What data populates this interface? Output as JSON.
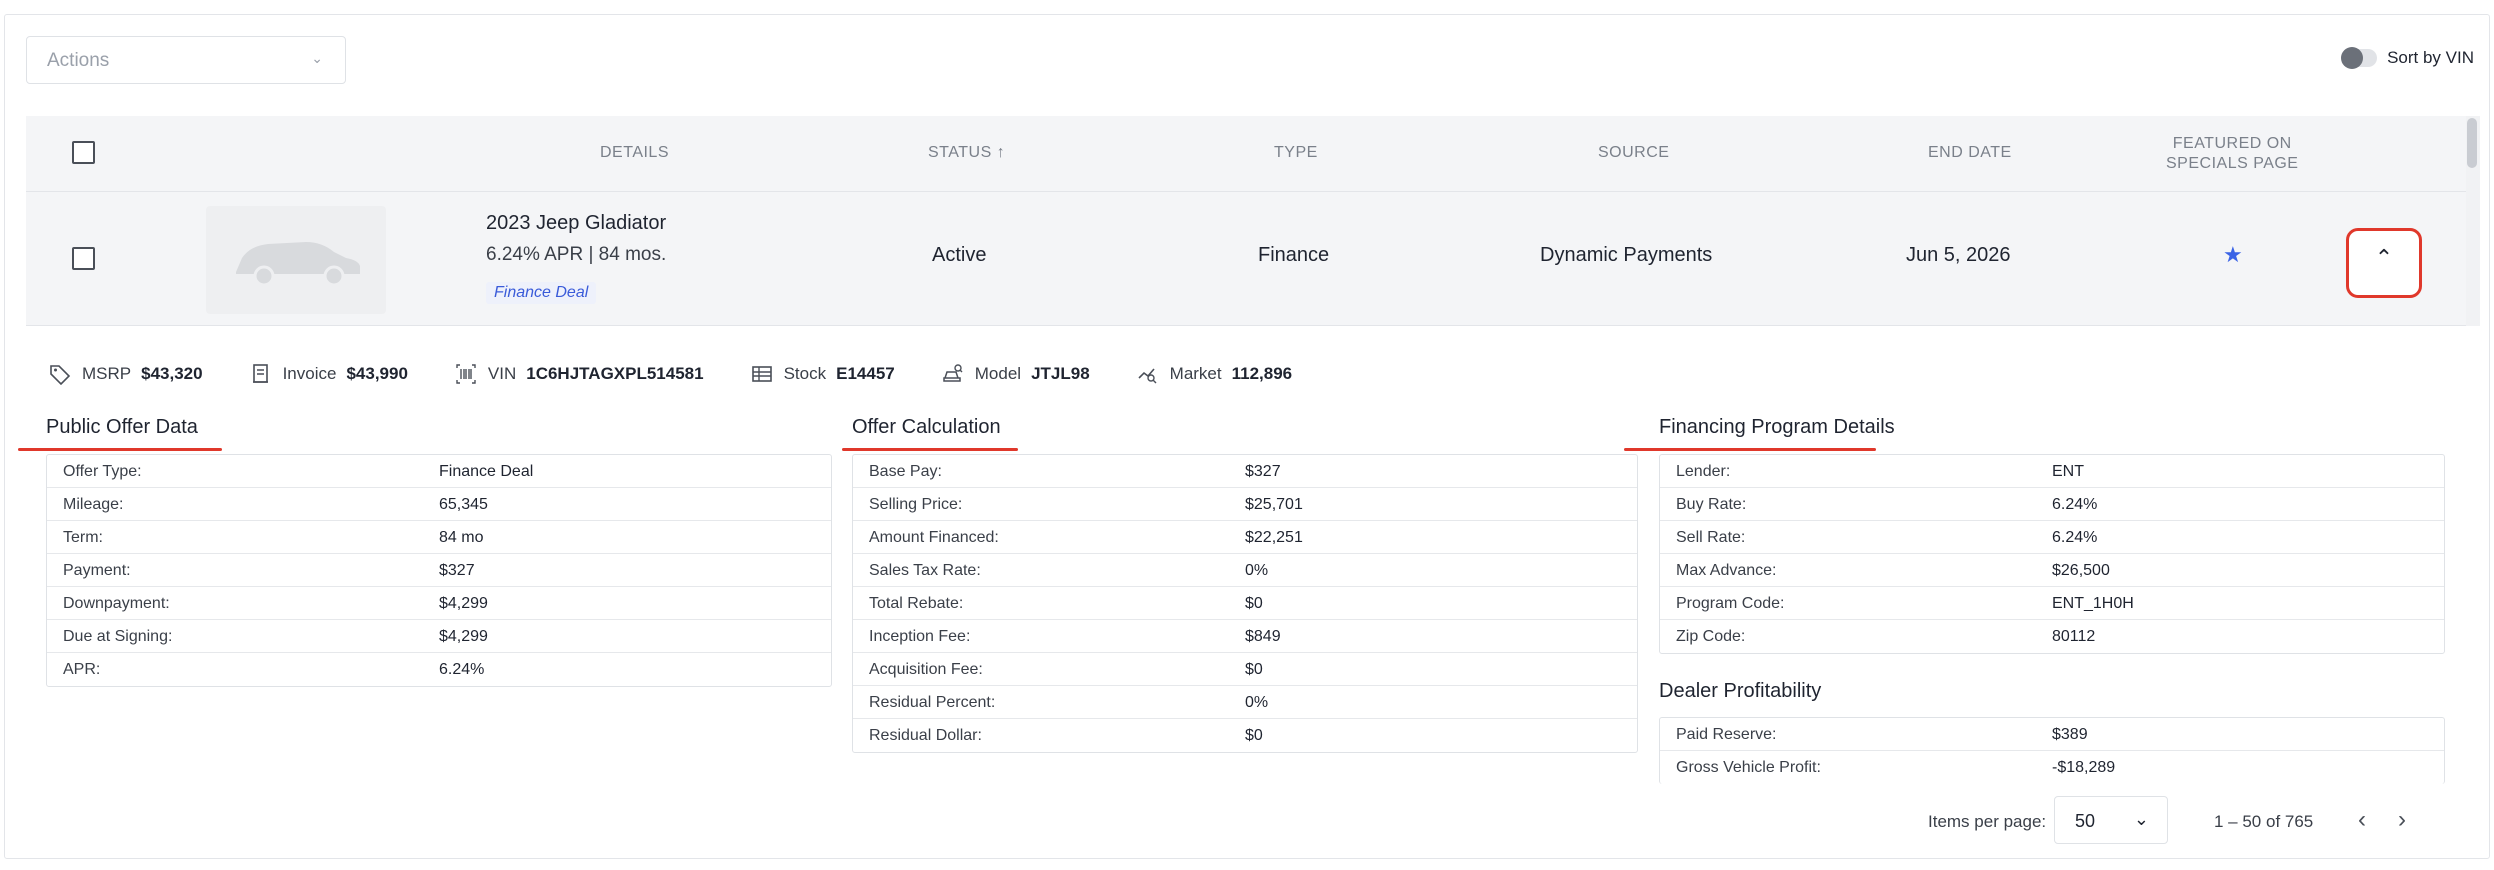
{
  "toolbar": {
    "actions_label": "Actions",
    "sort_by_vin_label": "Sort by VIN"
  },
  "table": {
    "columns": {
      "details": "DETAILS",
      "status": "STATUS ↑",
      "type": "TYPE",
      "source": "SOURCE",
      "end_date": "END DATE",
      "featured_line1": "FEATURED ON",
      "featured_line2": "SPECIALS PAGE"
    },
    "row": {
      "title": "2023 Jeep Gladiator",
      "subtitle": "6.24% APR | 84 mos.",
      "badge": "Finance Deal",
      "status": "Active",
      "type": "Finance",
      "source": "Dynamic Payments",
      "end_date": "Jun 5, 2026",
      "featured_icon": "star-icon",
      "expand_icon": "chevron-up-icon"
    }
  },
  "meta": {
    "msrp_label": "MSRP",
    "msrp_value": "$43,320",
    "invoice_label": "Invoice",
    "invoice_value": "$43,990",
    "vin_label": "VIN",
    "vin_value": "1C6HJTAGXPL514581",
    "stock_label": "Stock",
    "stock_value": "E14457",
    "model_label": "Model",
    "model_value": "JTJL98",
    "market_label": "Market",
    "market_value": "112,896"
  },
  "public_offer": {
    "title": "Public Offer Data",
    "rows": [
      {
        "k": "Offer Type:",
        "v": "Finance Deal"
      },
      {
        "k": "Mileage:",
        "v": "65,345"
      },
      {
        "k": "Term:",
        "v": "84 mo"
      },
      {
        "k": "Payment:",
        "v": "$327"
      },
      {
        "k": "Downpayment:",
        "v": "$4,299"
      },
      {
        "k": "Due at Signing:",
        "v": "$4,299"
      },
      {
        "k": "APR:",
        "v": "6.24%"
      }
    ]
  },
  "offer_calc": {
    "title": "Offer Calculation",
    "rows": [
      {
        "k": "Base Pay:",
        "v": "$327"
      },
      {
        "k": "Selling Price:",
        "v": "$25,701"
      },
      {
        "k": "Amount Financed:",
        "v": "$22,251"
      },
      {
        "k": "Sales Tax Rate:",
        "v": "0%"
      },
      {
        "k": "Total Rebate:",
        "v": "$0"
      },
      {
        "k": "Inception Fee:",
        "v": "$849"
      },
      {
        "k": "Acquisition Fee:",
        "v": "$0"
      },
      {
        "k": "Residual Percent:",
        "v": "0%"
      },
      {
        "k": "Residual Dollar:",
        "v": "$0"
      }
    ]
  },
  "financing": {
    "title": "Financing Program Details",
    "rows": [
      {
        "k": "Lender:",
        "v": "ENT"
      },
      {
        "k": "Buy Rate:",
        "v": "6.24%"
      },
      {
        "k": "Sell Rate:",
        "v": "6.24%"
      },
      {
        "k": "Max Advance:",
        "v": "$26,500"
      },
      {
        "k": "Program Code:",
        "v": "ENT_1H0H"
      },
      {
        "k": "Zip Code:",
        "v": "80112"
      }
    ]
  },
  "dealer": {
    "title": "Dealer Profitability",
    "rows": [
      {
        "k": "Paid Reserve:",
        "v": "$389"
      },
      {
        "k": "Gross Vehicle Profit:",
        "v": "-$18,289"
      }
    ]
  },
  "footer": {
    "items_per_page_label": "Items per page:",
    "items_per_page_value": "50",
    "range": "1 – 50 of 765"
  },
  "colors": {
    "accent_red": "#e0382b",
    "link_blue": "#3a5bd9",
    "star_blue": "#3a63e6"
  }
}
